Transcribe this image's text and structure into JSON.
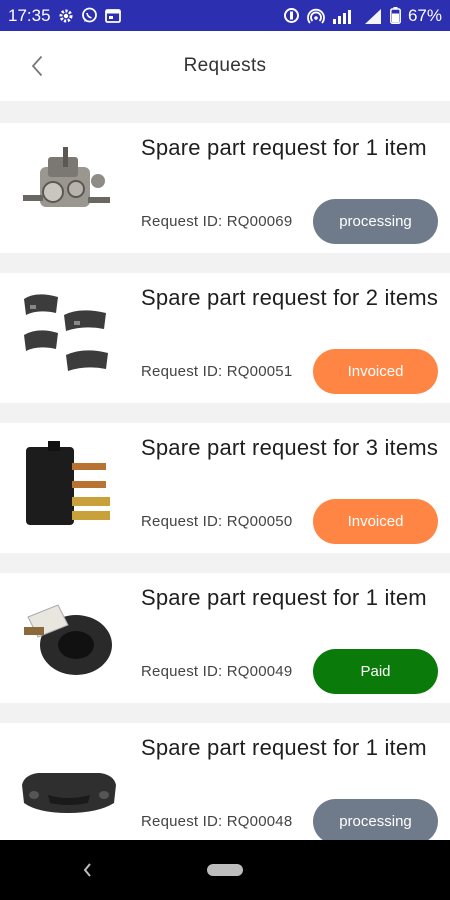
{
  "status_bar": {
    "time": "17:35",
    "battery": "67%"
  },
  "header": {
    "title": "Requests"
  },
  "requests": [
    {
      "title": "Spare part request for 1 item",
      "request_id": "Request ID: RQ00069",
      "status": "processing",
      "status_color": "#6f7a8b",
      "image": "gearbox"
    },
    {
      "title": "Spare part request for 2 items",
      "request_id": "Request ID: RQ00051",
      "status": "Invoiced",
      "status_color": "#ff8545",
      "image": "brake-pads"
    },
    {
      "title": "Spare part request for 3 items",
      "request_id": "Request ID: RQ00050",
      "status": "Invoiced",
      "status_color": "#ff8545",
      "image": "relay"
    },
    {
      "title": "Spare part request for 1 item",
      "request_id": "Request ID: RQ00049",
      "status": "Paid",
      "status_color": "#0a7a0a",
      "image": "throttle-sensor"
    },
    {
      "title": "Spare part request for 1 item",
      "request_id": "Request ID: RQ00048",
      "status": "processing",
      "status_color": "#6f7a8b",
      "image": "bumper"
    }
  ]
}
